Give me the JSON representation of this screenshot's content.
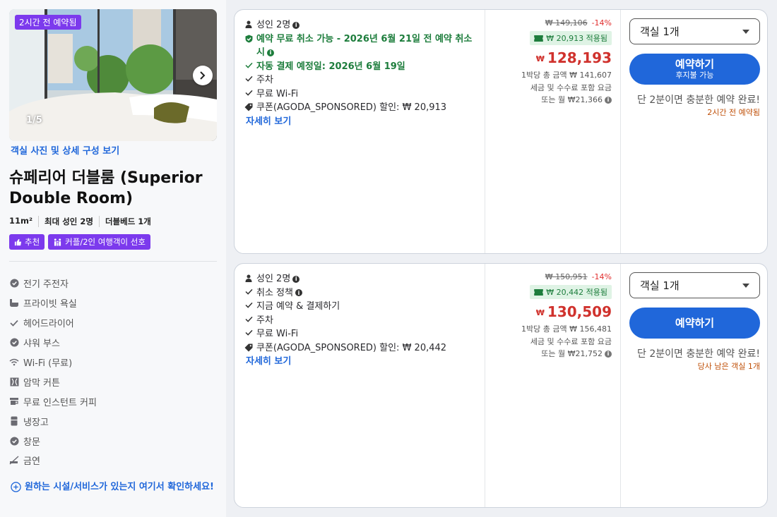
{
  "room": {
    "photo_badge": "2시간 전 예약됨",
    "photo_counter": "1/5",
    "view_photos_link": "객실 사진 및 상세 구성 보기",
    "title": "슈페리어 더블룸 (Superior Double Room)",
    "specs": [
      "11m²",
      "최대 성인 2명",
      "더블베드 1개"
    ],
    "tags": [
      {
        "label": "추천",
        "icon": "thumbs-up-icon"
      },
      {
        "label": "커플/2인 여행객이 선호",
        "icon": "people-icon"
      }
    ],
    "amenities": [
      {
        "label": "전기 주전자",
        "icon": "check-circle-icon"
      },
      {
        "label": "프라이빗 욕실",
        "icon": "bathtub-icon"
      },
      {
        "label": "헤어드라이어",
        "icon": "check-icon"
      },
      {
        "label": "샤워 부스",
        "icon": "check-circle-icon"
      },
      {
        "label": "Wi-Fi (무료)",
        "icon": "wifi-icon"
      },
      {
        "label": "암막 커튼",
        "icon": "curtain-icon"
      },
      {
        "label": "무료 인스턴트 커피",
        "icon": "coffee-icon"
      },
      {
        "label": "냉장고",
        "icon": "fridge-icon"
      },
      {
        "label": "창문",
        "icon": "check-circle-icon"
      },
      {
        "label": "금연",
        "icon": "no-smoking-icon"
      }
    ],
    "check_more_link": "원하는 시설/서비스가 있는지 여기서 확인하세요!"
  },
  "offers": [
    {
      "occupancy": "성인 2명",
      "features": [
        {
          "text": "예약 무료 취소 가능 - 2026년 6월 21일 전 예약 취소 시",
          "icon": "shield-check-icon",
          "green": true,
          "info": true
        },
        {
          "text": "자동 결제 예정일: 2026년 6월 19일",
          "icon": "check-icon",
          "green": true,
          "info": false
        },
        {
          "text": "주차",
          "icon": "check-icon",
          "green": false,
          "info": false
        },
        {
          "text": "무료 Wi-Fi",
          "icon": "check-icon",
          "green": false,
          "info": false
        },
        {
          "text": "쿠폰(AGODA_SPONSORED) 할인: ₩ 20,913",
          "icon": "tag-icon",
          "green": false,
          "info": false
        }
      ],
      "details_link": "자세히 보기",
      "original_price": "₩ 149,106",
      "discount": "-14%",
      "coupon_applied": "₩ 20,913 적용됨",
      "currency": "₩",
      "price": "128,193",
      "price_notes": [
        "1박당 총 금액 ₩ 141,607",
        "세금 및 수수료 포함 요금",
        "또는 월 ₩21,366"
      ],
      "rooms_select": "객실 1개",
      "book_label": "예약하기",
      "book_sub": "후지불 가능",
      "urgency": "단 2분이면 충분한 예약 완료!",
      "urgency_small": "2시간 전 예약됨"
    },
    {
      "occupancy": "성인 2명",
      "features": [
        {
          "text": "취소 정책",
          "icon": "check-icon",
          "green": false,
          "info": true
        },
        {
          "text": "지금 예약 & 결제하기",
          "icon": "check-icon",
          "green": false,
          "info": false
        },
        {
          "text": "주차",
          "icon": "check-icon",
          "green": false,
          "info": false
        },
        {
          "text": "무료 Wi-Fi",
          "icon": "check-icon",
          "green": false,
          "info": false
        },
        {
          "text": "쿠폰(AGODA_SPONSORED) 할인: ₩ 20,442",
          "icon": "tag-icon",
          "green": false,
          "info": false
        }
      ],
      "details_link": "자세히 보기",
      "original_price": "₩ 150,951",
      "discount": "-14%",
      "coupon_applied": "₩ 20,442 적용됨",
      "currency": "₩",
      "price": "130,509",
      "price_notes": [
        "1박당 총 금액 ₩ 156,481",
        "세금 및 수수료 포함 요금",
        "또는 월 ₩21,752"
      ],
      "rooms_select": "객실 1개",
      "book_label": "예약하기",
      "book_sub": "",
      "urgency": "단 2분이면 충분한 예약 완료!",
      "urgency_small": "당사 남은 객실 1개"
    }
  ],
  "colors": {
    "accent": "#2067da",
    "tag": "#7c3aed",
    "price": "#d0322d",
    "green": "#1d7d3c"
  }
}
